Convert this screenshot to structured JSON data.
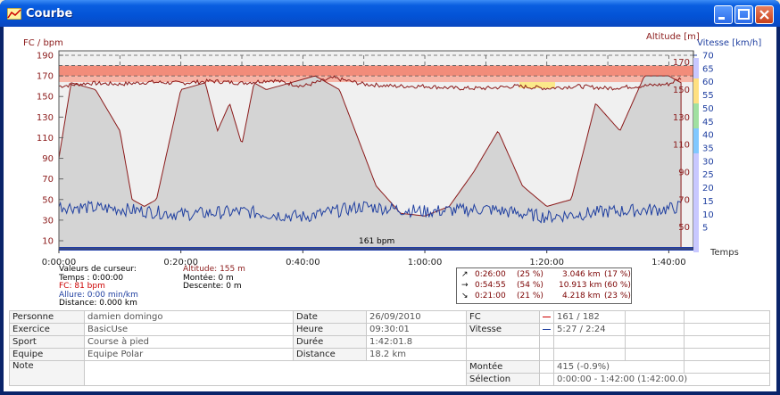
{
  "window": {
    "title": "Courbe"
  },
  "chart_data": {
    "type": "line",
    "left_axis_label": "FC / bpm",
    "left_ticks": [
      "190",
      "170",
      "150",
      "130",
      "110",
      "90",
      "70",
      "50",
      "30",
      "10"
    ],
    "alt_axis_label": "Altitude [m]",
    "alt_ticks": [
      "170",
      "150",
      "130",
      "110",
      "90",
      "70",
      "50"
    ],
    "speed_axis_label": "Vitesse [km/h]",
    "speed_ticks": [
      "70",
      "65",
      "60",
      "55",
      "50",
      "45",
      "40",
      "35",
      "30",
      "25",
      "20",
      "15",
      "10",
      "5"
    ],
    "x_label": "Temps",
    "x_ticks": [
      "0:00:00",
      "0:20:00",
      "0:40:00",
      "1:00:00",
      "1:20:00",
      "1:40:00"
    ],
    "cursor_hr_label": "161 bpm",
    "colors": {
      "hr": "#8b1a1a",
      "speed": "#1f3fa0",
      "altitude_fill": "#d6d6d6",
      "zone_red": "#f28c7a",
      "zone_yellow": "#fbe98a"
    },
    "series": [
      {
        "name": "FC",
        "x_min": [
          0,
          5,
          10,
          15,
          20,
          25,
          30,
          35,
          40,
          45,
          50,
          55,
          60,
          65,
          70,
          75,
          80,
          85,
          90,
          95,
          100,
          102
        ],
        "values": [
          160,
          163,
          162,
          164,
          163,
          165,
          163,
          166,
          160,
          168,
          162,
          160,
          160,
          158,
          158,
          160,
          158,
          160,
          158,
          160,
          162,
          168
        ]
      },
      {
        "name": "Altitude",
        "x_min": [
          0,
          2,
          6,
          10,
          12,
          14,
          16,
          20,
          24,
          26,
          28,
          30,
          32,
          34,
          38,
          42,
          46,
          52,
          56,
          60,
          64,
          68,
          72,
          76,
          80,
          84,
          88,
          92,
          94,
          96,
          100,
          102
        ],
        "values": [
          100,
          155,
          150,
          120,
          70,
          65,
          70,
          150,
          155,
          120,
          140,
          110,
          155,
          150,
          155,
          160,
          150,
          80,
          60,
          58,
          65,
          90,
          120,
          80,
          65,
          70,
          140,
          120,
          140,
          160,
          160,
          155
        ]
      },
      {
        "name": "Vitesse",
        "x_min": [
          0,
          10,
          20,
          30,
          40,
          50,
          60,
          70,
          80,
          90,
          100,
          102
        ],
        "values": [
          13,
          12,
          10,
          11,
          9,
          13,
          11,
          12,
          9,
          11,
          12,
          13
        ]
      }
    ]
  },
  "cursor": {
    "title": "Valeurs de curseur:",
    "temps": "Temps : 0:00:00",
    "fc": "FC: 81 bpm",
    "allure": "Allure: 0:00 min/km",
    "distance": "Distance: 0.000 km",
    "altitude": "Altitude: 155 m",
    "montee": "Montée: 0 m",
    "descente": "Descente: 0 m"
  },
  "stats": [
    {
      "icon": "↗",
      "time": "0:26:00",
      "pct": "(25 %)",
      "km": "3.046 km",
      "kpct": "(17 %)"
    },
    {
      "icon": "→",
      "time": "0:54:55",
      "pct": "(54 %)",
      "km": "10.913 km",
      "kpct": "(60 %)"
    },
    {
      "icon": "↘",
      "time": "0:21:00",
      "pct": "(21 %)",
      "km": "4.218 km",
      "kpct": "(23 %)"
    }
  ],
  "info": {
    "personne_l": "Personne",
    "personne_v": "damien domingo",
    "exercice_l": "Exercice",
    "exercice_v": "BasicUse",
    "sport_l": "Sport",
    "sport_v": "Course à pied",
    "equipe_l": "Equipe",
    "equipe_v": "Equipe Polar",
    "note_l": "Note",
    "date_l": "Date",
    "date_v": "26/09/2010",
    "heure_l": "Heure",
    "heure_v": "09:30:01",
    "duree_l": "Durée",
    "duree_v": "1:42:01.8",
    "distance_l": "Distance",
    "distance_v": "18.2 km",
    "fc_l": "FC",
    "fc_v": "161 / 182",
    "vitesse_l": "Vitesse",
    "vitesse_v": "5:27 / 2:24",
    "montee_l": "Montée",
    "montee_v": "415 (-0.9%)",
    "selection_l": "Sélection",
    "selection_v": "0:00:00 - 1:42:00 (1:42:00.0)"
  }
}
